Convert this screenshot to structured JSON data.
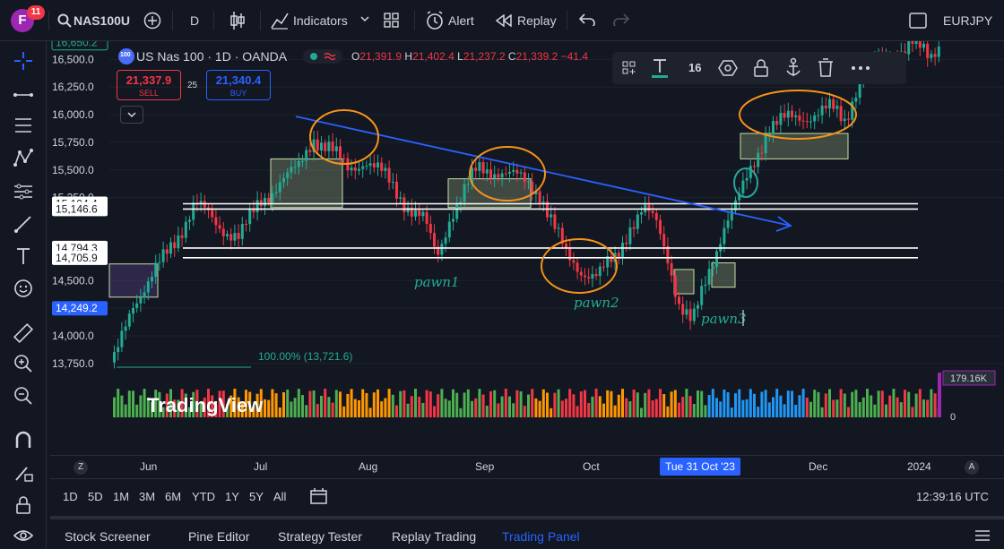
{
  "user": {
    "initial": "F",
    "notifications": "11"
  },
  "toolbar": {
    "symbol": "NAS100U",
    "interval": "D",
    "indicators_label": "Indicators",
    "alert_label": "Alert",
    "replay_label": "Replay",
    "right_symbol": "EURJPY"
  },
  "legend": {
    "title": "US Nas 100 · 1D · OANDA",
    "logo": "100",
    "open_label": "O",
    "open": "21,391.9",
    "high_label": "H",
    "high": "21,402.4",
    "low_label": "L",
    "low": "21,237.2",
    "close_label": "C",
    "close": "21,339.2",
    "change": "−41.4"
  },
  "trade": {
    "sell_price": "21,337.9",
    "sell_label": "SELL",
    "spread": "25",
    "buy_price": "21,340.4",
    "buy_label": "BUY"
  },
  "draw_toolbar": {
    "font_size": "16"
  },
  "price_axis": {
    "ticks": [
      "16,500.0",
      "16,250.0",
      "16,000.0",
      "15,750.0",
      "15,500.0",
      "15,250.0",
      "14,500.0",
      "14,250.0",
      "14,000.0",
      "13,750.0"
    ],
    "top_label": "16,650.2",
    "line_labels": [
      "15,194.4",
      "15,146.6",
      "14,794.3",
      "14,705.9"
    ],
    "current": "14,249.2",
    "volume_label": "179.16K",
    "volume_zero": "0"
  },
  "annotations": {
    "fib": "100.00% (13,721.6)",
    "pawn1": "pawn1",
    "pawn2": "pawn2",
    "pawn3": "pawn3"
  },
  "watermark": "TradingView",
  "time_axis": {
    "labels": [
      "Jun",
      "Jul",
      "Aug",
      "Sep",
      "Oct",
      "Dec",
      "2024"
    ],
    "highlight": "Tue 31 Oct '23",
    "z_left": "Z",
    "a_right": "A"
  },
  "ranges": [
    "1D",
    "5D",
    "1M",
    "3M",
    "6M",
    "YTD",
    "1Y",
    "5Y",
    "All"
  ],
  "clock": "12:39:16 UTC",
  "bottom_tabs": [
    "Stock Screener",
    "Pine Editor",
    "Strategy Tester",
    "Replay Trading",
    "Trading Panel"
  ],
  "colors": {
    "up": "#22ab94",
    "down": "#f23645",
    "trend": "#2962ff",
    "ellipse": "#f7931a",
    "zone": "#c5e1a5"
  }
}
